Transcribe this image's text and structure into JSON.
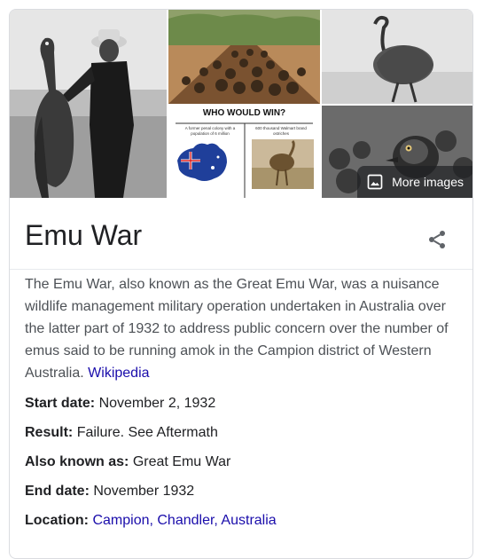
{
  "gallery": {
    "more_images_label": "More images",
    "who_would_win": {
      "title": "WHO WOULD WIN?",
      "left_caption": "A former penal colony with a population of 6 million",
      "right_caption": "600 thousand Walmart brand ostriches"
    }
  },
  "entity": {
    "title": "Emu War"
  },
  "description": {
    "text": "The Emu War, also known as the Great Emu War, was a nuisance wildlife management military operation undertaken in Australia over the latter part of 1932 to address public concern over the number of emus said to be running amok in the Campion district of Western Australia.",
    "source_link": "Wikipedia"
  },
  "facts": [
    {
      "label": "Start date:",
      "value": "November 2, 1932",
      "is_link": false
    },
    {
      "label": "Result:",
      "value": "Failure. See Aftermath",
      "is_link": false
    },
    {
      "label": "Also known as:",
      "value": "Great Emu War",
      "is_link": false
    },
    {
      "label": "End date:",
      "value": "November 1932",
      "is_link": false
    },
    {
      "label": "Location:",
      "value": "Campion, Chandler, Australia",
      "is_link": true
    }
  ],
  "colors": {
    "link": "#1a0dab",
    "text": "#202124",
    "secondary_text": "#4d5156",
    "divider": "#dadce0"
  },
  "icons": {
    "more_images": "image-icon",
    "share": "share-icon"
  }
}
